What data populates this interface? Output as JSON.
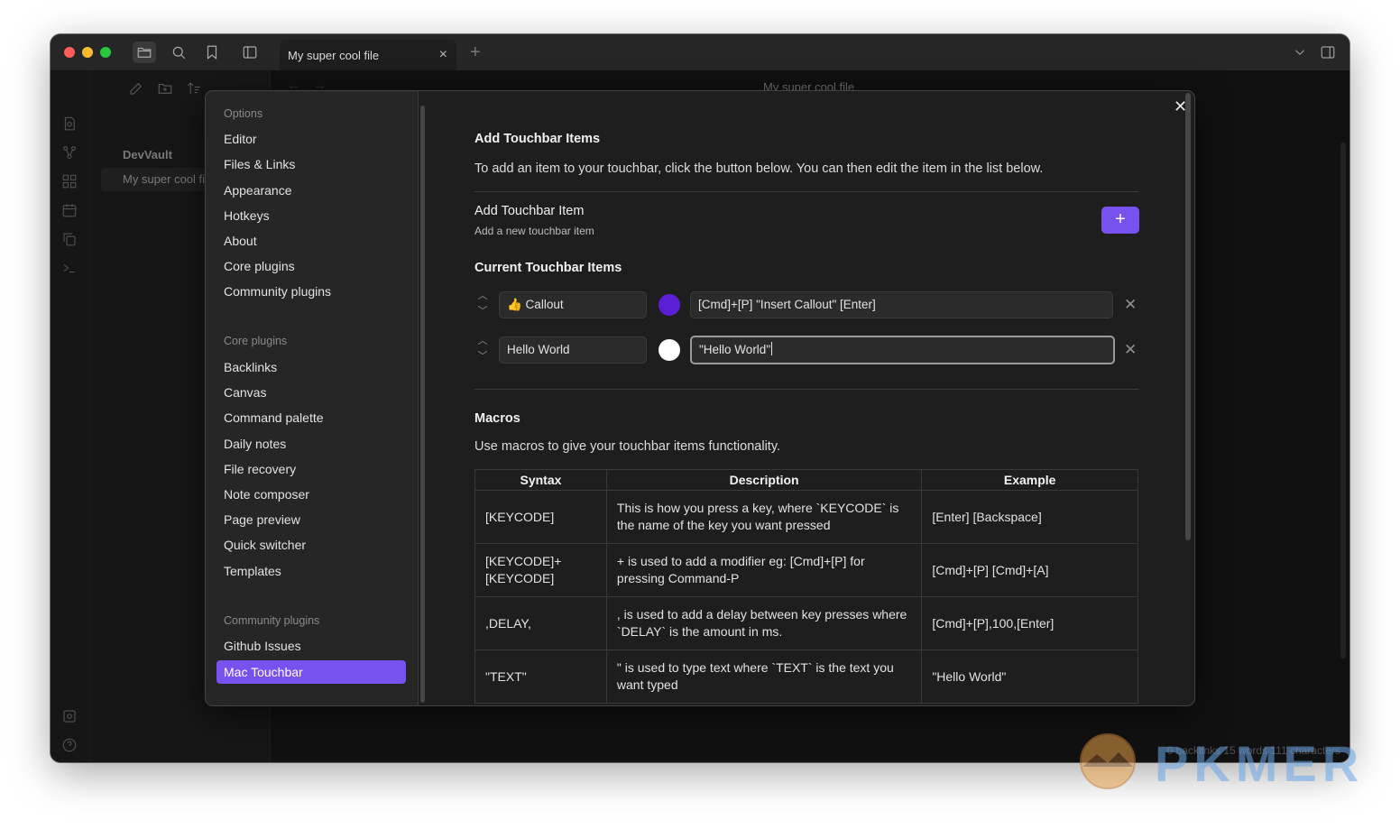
{
  "app": {
    "tab_title": "My super cool file",
    "editor_title": "My super cool file",
    "vault_name": "DevVault",
    "open_file": "My super cool file",
    "status_bar": "0 backlinks   15 words   111 characters"
  },
  "settings_nav": {
    "options_header": "Options",
    "options": [
      "Editor",
      "Files & Links",
      "Appearance",
      "Hotkeys",
      "About",
      "Core plugins",
      "Community plugins"
    ],
    "core_header": "Core plugins",
    "core": [
      "Backlinks",
      "Canvas",
      "Command palette",
      "Daily notes",
      "File recovery",
      "Note composer",
      "Page preview",
      "Quick switcher",
      "Templates"
    ],
    "community_header": "Community plugins",
    "community": [
      "Github Issues",
      "Mac Touchbar"
    ],
    "active": "Mac Touchbar"
  },
  "content": {
    "add_heading": "Add Touchbar Items",
    "add_description": "To add an item to your touchbar, click the button below. You can then edit the item in the list below.",
    "add_item_name": "Add Touchbar Item",
    "add_item_desc": "Add a new touchbar item",
    "add_button": "+",
    "current_heading": "Current Touchbar Items",
    "items": [
      {
        "label": "👍 Callout",
        "color": "#5b1fd6",
        "macro": "[Cmd]+[P] \"Insert Callout\" [Enter]"
      },
      {
        "label": "Hello World",
        "color": "#ffffff",
        "macro": "\"Hello World\""
      }
    ],
    "macros_heading": "Macros",
    "macros_description": "Use macros to give your touchbar items functionality.",
    "table_headers": [
      "Syntax",
      "Description",
      "Example"
    ],
    "table_rows": [
      [
        "[KEYCODE]",
        "This is how you press a key, where `KEYCODE` is the name of the key you want pressed",
        "[Enter] [Backspace]"
      ],
      [
        "[KEYCODE]+[KEYCODE]",
        "+ is used to add a modifier eg: [Cmd]+[P] for pressing Command-P",
        "[Cmd]+[P] [Cmd]+[A]"
      ],
      [
        ",DELAY,",
        ", is used to add a delay between key presses where `DELAY` is the amount in ms.",
        "[Cmd]+[P],100,[Enter]"
      ],
      [
        "\"TEXT\"",
        "\" is used to type text where `TEXT` is the text you want typed",
        "\"Hello World\""
      ]
    ]
  },
  "watermark": {
    "text": "PKMER"
  },
  "colors": {
    "accent": "#7852ee",
    "background": "#1e1e1e",
    "panel": "#262626"
  }
}
